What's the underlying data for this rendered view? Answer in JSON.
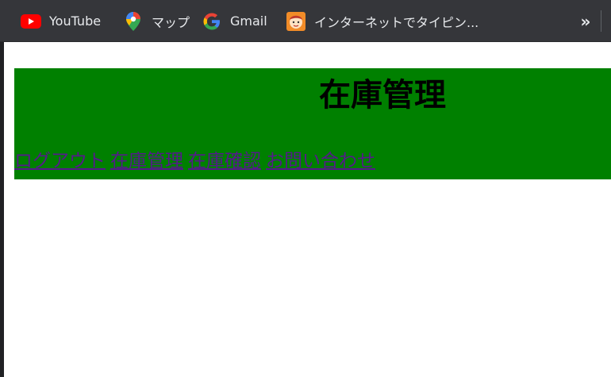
{
  "bookmarks": {
    "items": [
      {
        "label": "YouTube",
        "icon": "youtube-icon"
      },
      {
        "label": "マップ",
        "icon": "maps-pin-icon"
      },
      {
        "label": "Gmail",
        "icon": "google-g-icon"
      },
      {
        "label": "インターネットでタイピン...",
        "icon": "typing-site-icon"
      }
    ],
    "overflow": "»"
  },
  "page": {
    "title": "在庫管理",
    "nav": [
      "ログアウト",
      "在庫管理",
      "在庫確認",
      "お問い合わせ"
    ]
  },
  "colors": {
    "bookmarks_bar_bg": "#35363a",
    "header_bg": "#008000",
    "link": "#551a8b"
  }
}
